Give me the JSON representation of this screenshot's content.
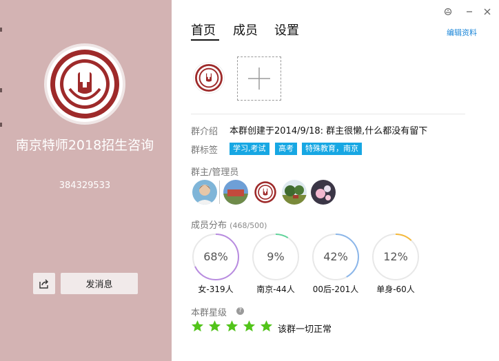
{
  "group": {
    "name": "南京特师2018招生咨询",
    "number": "384329533"
  },
  "left": {
    "send_message_label": "发消息"
  },
  "tabs": [
    {
      "label": "首页",
      "active": true
    },
    {
      "label": "成员",
      "active": false
    },
    {
      "label": "设置",
      "active": false
    }
  ],
  "header": {
    "edit_link": "编辑资料"
  },
  "intro": {
    "label": "群介绍",
    "text": "本群创建于2014/9/18:  群主很懒,什么都没有留下"
  },
  "tags": {
    "label": "群标签",
    "items": [
      "学习,考试",
      "高考",
      "特殊教育，南京"
    ]
  },
  "admins": {
    "label": "群主/管理员"
  },
  "distribution": {
    "label": "成员分布",
    "count": "(468/500)",
    "items": [
      {
        "percent": "68%",
        "value": 68,
        "caption": "女-319人",
        "color": "#b88be0"
      },
      {
        "percent": "9%",
        "value": 9,
        "caption": "南京-44人",
        "color": "#5fd49a"
      },
      {
        "percent": "42%",
        "value": 42,
        "caption": "00后-201人",
        "color": "#8bb6ea"
      },
      {
        "percent": "12%",
        "value": 12,
        "caption": "单身-60人",
        "color": "#f5b93a"
      }
    ]
  },
  "level": {
    "label": "本群星级",
    "stars": 5,
    "text": "该群一切正常",
    "star_color": "#52c41a"
  },
  "colors": {
    "left_bg": "#d3b3b3",
    "tag_bg": "#17a7e3",
    "link": "#1b86d8"
  }
}
